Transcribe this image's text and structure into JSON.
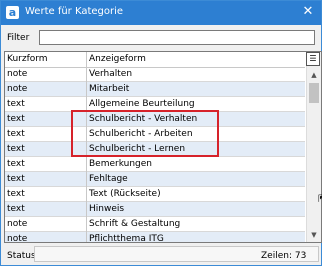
{
  "window": {
    "title": "Werte für Kategorie",
    "app_icon_glyph": "a",
    "close_glyph": "✕"
  },
  "filter": {
    "label": "Filter",
    "value": ""
  },
  "grid": {
    "columns": [
      "Kurzform",
      "Anzeigeform"
    ],
    "rows": [
      [
        "note",
        "Verhalten"
      ],
      [
        "note",
        "Mitarbeit"
      ],
      [
        "text",
        "Allgemeine Beurteilung"
      ],
      [
        "text",
        "Schulbericht - Verhalten"
      ],
      [
        "text",
        "Schulbericht - Arbeiten"
      ],
      [
        "text",
        "Schulbericht - Lernen"
      ],
      [
        "text",
        "Bemerkungen"
      ],
      [
        "text",
        "Fehltage"
      ],
      [
        "text",
        "Text (Rückseite)"
      ],
      [
        "text",
        "Hinweis"
      ],
      [
        "note",
        "Schrift & Gestaltung"
      ],
      [
        "note",
        "Pflichtthema ITG"
      ]
    ]
  },
  "status": {
    "label": "Status",
    "count": "Zeilen: 73"
  },
  "colors": {
    "titlebar": "#2d7fd2",
    "row_alt": "#e3ecf7",
    "highlight": "#d6222a"
  }
}
